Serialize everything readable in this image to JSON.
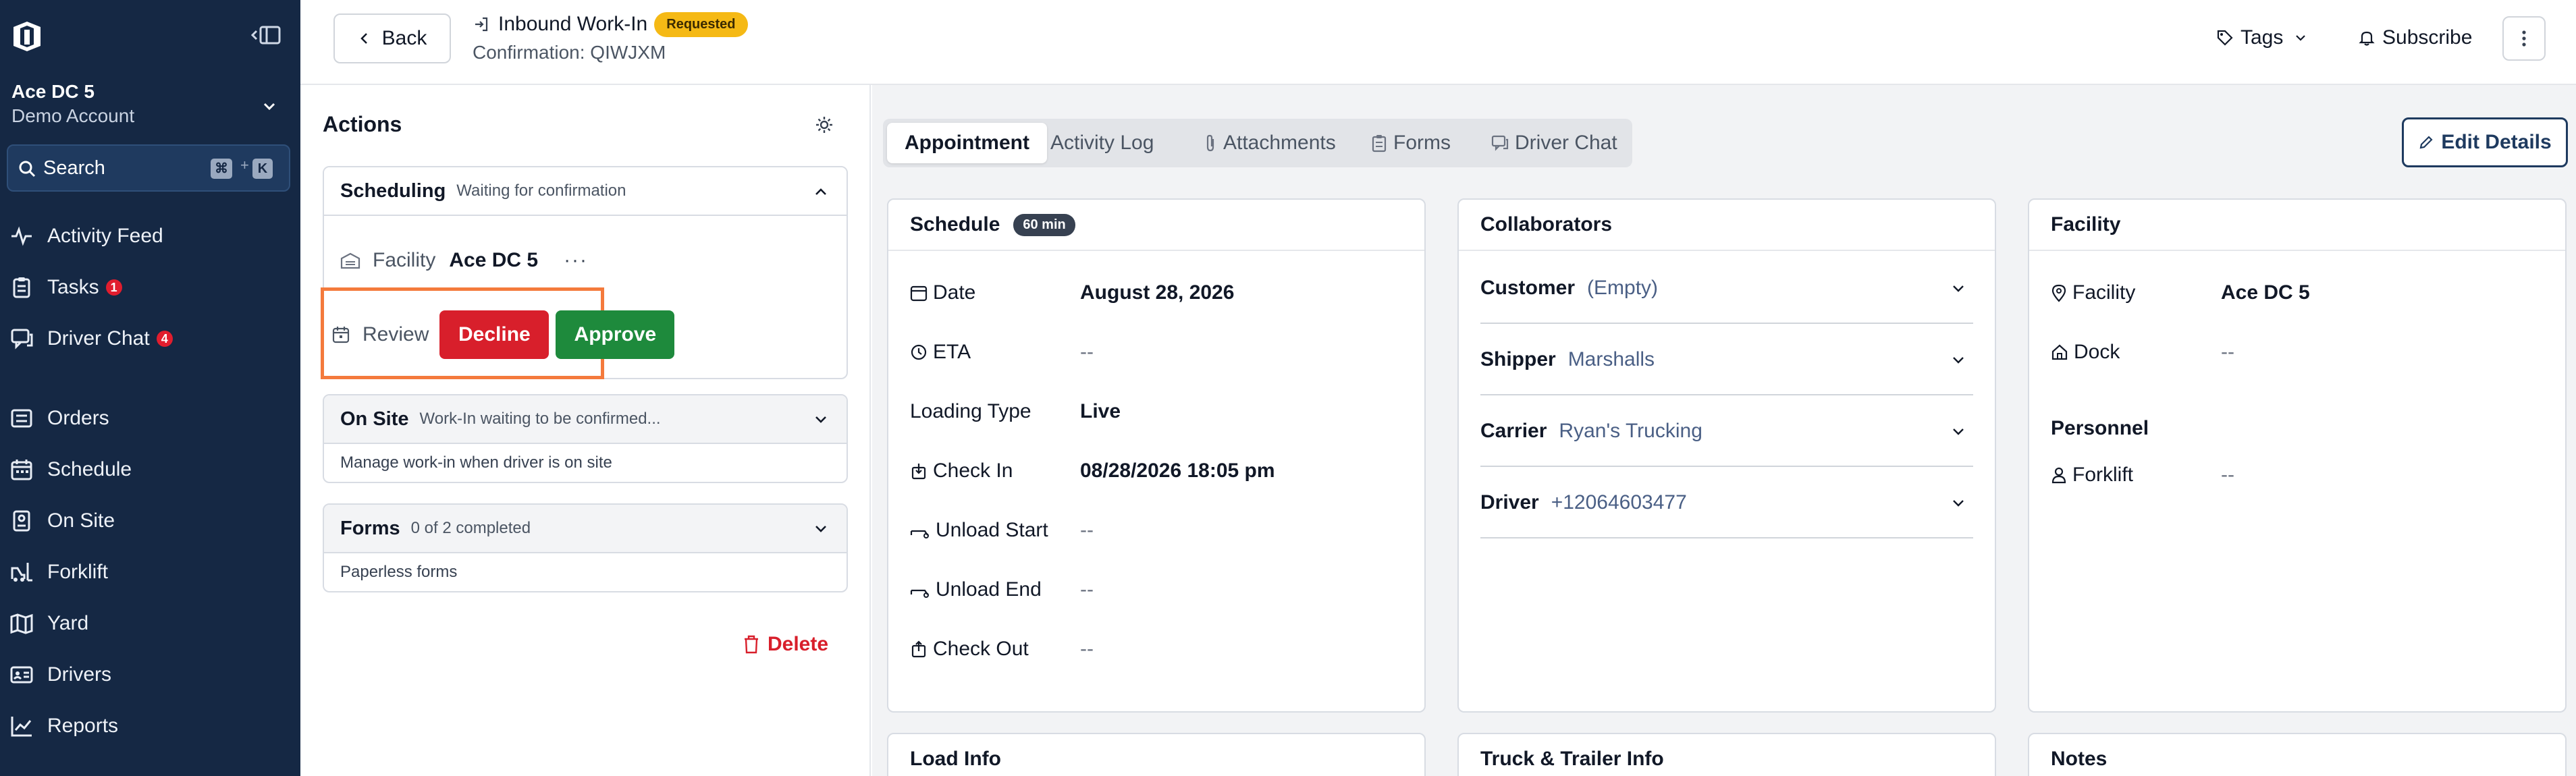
{
  "sidebar": {
    "account_name": "Ace DC 5",
    "account_sub": "Demo Account",
    "search_label": "Search",
    "search_shortcut": [
      "⌘",
      "+",
      "K"
    ],
    "nav": [
      {
        "label": "Activity Feed",
        "icon": "activity-icon"
      },
      {
        "label": "Tasks",
        "icon": "clipboard-icon",
        "badge": "1"
      },
      {
        "label": "Driver Chat",
        "icon": "chat-icon",
        "badge": "4"
      },
      {
        "label": "Orders",
        "icon": "list-icon"
      },
      {
        "label": "Schedule",
        "icon": "calendar-icon"
      },
      {
        "label": "On Site",
        "icon": "building-icon"
      },
      {
        "label": "Forklift",
        "icon": "forklift-icon"
      },
      {
        "label": "Yard",
        "icon": "map-icon"
      },
      {
        "label": "Drivers",
        "icon": "id-card-icon"
      },
      {
        "label": "Reports",
        "icon": "chart-icon"
      }
    ]
  },
  "header": {
    "back_label": "Back",
    "title": "Inbound Work-In",
    "status": "Requested",
    "confirmation": "Confirmation: QIWJXM",
    "tags_label": "Tags",
    "subscribe_label": "Subscribe",
    "status_color": "#f5b915"
  },
  "actions": {
    "title": "Actions",
    "scheduling": {
      "title": "Scheduling",
      "subtitle": "Waiting for confirmation",
      "facility_key": "Facility",
      "facility_value": "Ace DC 5",
      "more": "···",
      "review_label": "Review",
      "decline_label": "Decline",
      "approve_label": "Approve"
    },
    "on_site": {
      "title": "On Site",
      "subtitle": "Work-In waiting to be confirmed...",
      "body": "Manage work-in when driver is on site"
    },
    "forms": {
      "title": "Forms",
      "subtitle": "0 of 2 completed",
      "body": "Paperless forms"
    },
    "delete_label": "Delete"
  },
  "tabs": [
    {
      "label": "Appointment",
      "active": true
    },
    {
      "label": "Activity Log"
    },
    {
      "label": "Attachments",
      "icon": "paperclip-icon"
    },
    {
      "label": "Forms",
      "icon": "clipboard-icon"
    },
    {
      "label": "Driver Chat",
      "icon": "chat-icon"
    }
  ],
  "edit_details_label": "Edit Details",
  "schedule": {
    "title": "Schedule",
    "duration": "60 min",
    "rows": [
      {
        "key": "Date",
        "value": "August 28, 2026",
        "icon": "calendar-icon"
      },
      {
        "key": "ETA",
        "value": "--",
        "icon": "clock-icon"
      },
      {
        "key": "Loading Type",
        "value": "Live"
      },
      {
        "key": "Check In",
        "value": "08/28/2026 18:05 pm",
        "icon": "check-in-icon"
      },
      {
        "key": "Unload Start",
        "value": "--",
        "icon": "dolly-icon"
      },
      {
        "key": "Unload End",
        "value": "--",
        "icon": "dolly-icon"
      },
      {
        "key": "Check Out",
        "value": "--",
        "icon": "check-out-icon"
      }
    ]
  },
  "collaborators": {
    "title": "Collaborators",
    "rows": [
      {
        "key": "Customer",
        "value": "(Empty)"
      },
      {
        "key": "Shipper",
        "value": "Marshalls"
      },
      {
        "key": "Carrier",
        "value": "Ryan's Trucking"
      },
      {
        "key": "Driver",
        "value": "+12064603477"
      }
    ]
  },
  "facility": {
    "title": "Facility",
    "facility_key": "Facility",
    "facility_value": "Ace DC 5",
    "dock_key": "Dock",
    "dock_value": "--",
    "personnel_title": "Personnel",
    "forklift_key": "Forklift",
    "forklift_value": "--"
  },
  "bottom_panels": {
    "load_info": "Load Info",
    "truck_trailer": "Truck & Trailer Info",
    "notes": "Notes"
  },
  "colors": {
    "sidebar_bg": "#152844",
    "decline": "#d81f2b",
    "approve": "#1e8a3c",
    "highlight": "#f47a3c",
    "badge": "#e11d2e"
  }
}
